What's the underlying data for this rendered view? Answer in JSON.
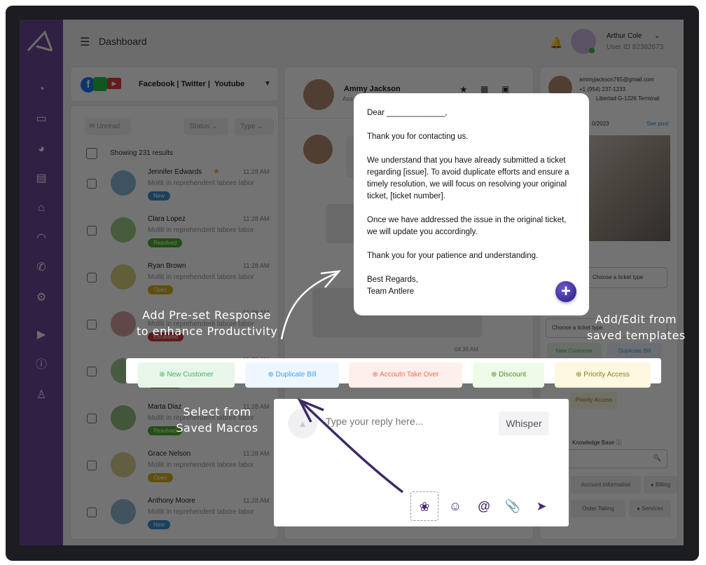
{
  "header": {
    "title": "Dashboard",
    "user_name": "Arthur Cole",
    "user_id": "User ID 82382673"
  },
  "sidebar": {
    "icons": [
      "dashboard-icon",
      "ticket-icon",
      "pie-chart-icon",
      "board-icon",
      "inbox-icon",
      "gauge-icon",
      "phone-icon",
      "gear-icon",
      "video-icon",
      "info-icon",
      "user-icon"
    ]
  },
  "channels": {
    "label_facebook": "Facebook",
    "sep1": "|",
    "label_twitter": "Twitter",
    "sep2": "|",
    "label_youtube": "Youtube"
  },
  "filters": {
    "unread": "Unread",
    "status": "Status",
    "type": "Type",
    "showing": "Showing 231 results"
  },
  "conversations": [
    {
      "name": "Jennifer Edwards",
      "preview": "Mollit in reprehenderit labore labor",
      "time": "11:28 AM",
      "status": "New",
      "starred": true
    },
    {
      "name": "Clara Lopez",
      "preview": "Mollit in reprehenderit labore labor",
      "time": "11:28 AM",
      "status": "Resolved"
    },
    {
      "name": "Ryan Brown",
      "preview": "Mollit in reprehenderit labore labor",
      "time": "11:28 AM",
      "status": "Open"
    },
    {
      "name": "",
      "preview": "Mollit in reprehenderit labore labor",
      "time": "11:28 AM",
      "status": "Escalated"
    },
    {
      "name": "",
      "preview": "Mollit in reprehenderit labore labor",
      "time": "11:28 AM",
      "status": "Resolved"
    },
    {
      "name": "Marta Diaz",
      "preview": "Mollit in reprehenderit labore labor",
      "time": "11:28 AM",
      "status": "Resolved"
    },
    {
      "name": "Grace Nelson",
      "preview": "Mollit in reprehenderit labore labor",
      "time": "11:28 AM",
      "status": "Open"
    },
    {
      "name": "Anthony Moore",
      "preview": "Mollit in reprehenderit labore labor",
      "time": "11:28 AM",
      "status": "New"
    }
  ],
  "status_colors": {
    "New": "#3a8fd0",
    "Resolved": "#4caf2a",
    "Open": "#d4b020",
    "Escalated": "#d03a3a"
  },
  "chat": {
    "contact_name": "Ammy Jackson",
    "contact_sub": "Ass",
    "message_time": "04:36 AM"
  },
  "contact": {
    "email": "ammyjackson765@gmail.com",
    "phone": "+1 (954) 237-1233",
    "address": "Libertad G-1226 Terminal",
    "date": "0/2023",
    "see_post": "See post",
    "ticket_type_1": "Choose a ticket type",
    "ticket_type_2": "Choose a ticket type",
    "tags": [
      "New Customer",
      "Duplicate Bill",
      "Priority Access"
    ],
    "kb_label": "Knowledge Base",
    "kb_chips": [
      "Account Information",
      "Billing",
      "Order Taking",
      "Services"
    ]
  },
  "template": {
    "paragraphs": [
      "Dear _____________,",
      "Thank you for contacting us.",
      "We understand that you have already submitted a ticket regarding [issue]. To avoid duplicate efforts and ensure a timely resolution, we will focus on resolving your original ticket, [ticket number].",
      "Once we have addressed the issue in the original ticket, we will update you accordingly.",
      "Thank you for your patience and understanding."
    ],
    "sign_1": "Best Regards,",
    "sign_2": "Team Antlere"
  },
  "macros": [
    {
      "label": "New Customer",
      "bg": "#e8f6ea",
      "fg": "#3cb55a"
    },
    {
      "label": "Duplicate Bill",
      "bg": "#eef7ff",
      "fg": "#3aa0f0"
    },
    {
      "label": "Accoutn Take Over",
      "bg": "#fdf0ec",
      "fg": "#f06a50"
    },
    {
      "label": "Discount",
      "bg": "#effbe9",
      "fg": "#4a8a22"
    },
    {
      "label": "Priority Access",
      "bg": "#fdf8e0",
      "fg": "#8a7a20"
    }
  ],
  "reply": {
    "placeholder": "Type your reply here...",
    "whisper": "Whisper"
  },
  "annotations": {
    "preset_1": "Add Pre-set Response",
    "preset_2": "to enhance Productivity",
    "macros_1": "Select from",
    "macros_2": "Saved Macros",
    "templates_1": "Add/Edit from",
    "templates_2": "saved templates"
  },
  "accent": "#4a2d6e"
}
